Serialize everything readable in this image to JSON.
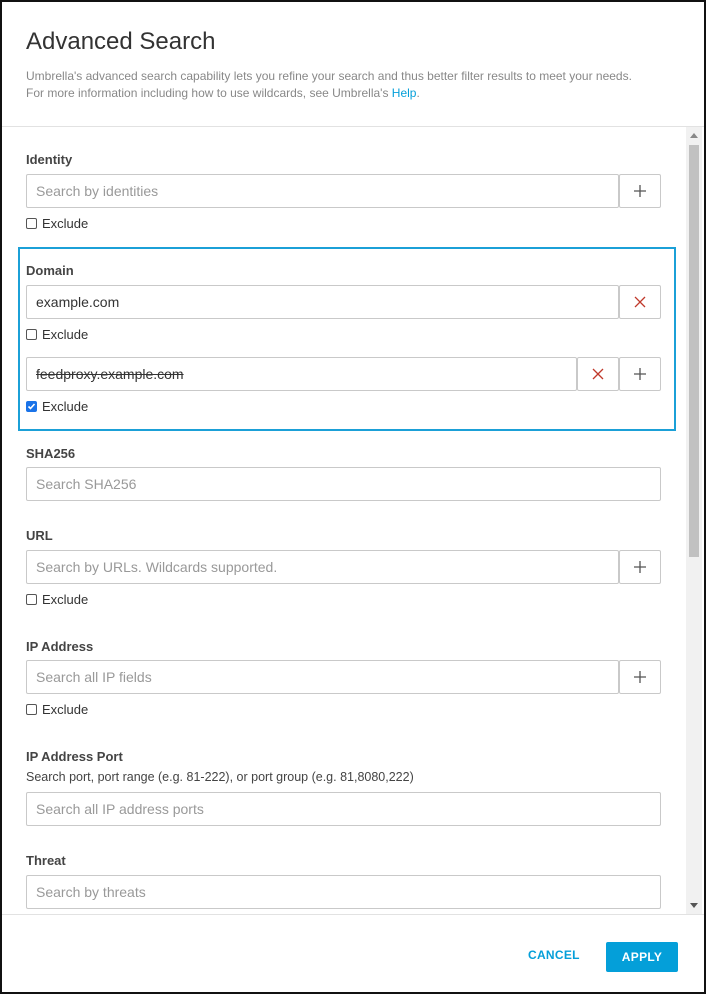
{
  "dialog": {
    "title": "Advanced Search",
    "description_line1": "Umbrella's advanced search capability lets you refine your search and thus better filter results to meet your needs.",
    "description_line2_prefix": "For more information including how to use wildcards, see Umbrella's",
    "help_link": "Help",
    "description_line2_suffix": "."
  },
  "identity": {
    "label": "Identity",
    "placeholder": "Search by identities",
    "exclude_label": "Exclude",
    "exclude_checked": false
  },
  "domain": {
    "label": "Domain",
    "entries": [
      {
        "value": "example.com",
        "exclude_label": "Exclude",
        "exclude_checked": false
      },
      {
        "value": "feedproxy.example.com",
        "exclude_label": "Exclude",
        "exclude_checked": true
      }
    ]
  },
  "sha256": {
    "label": "SHA256",
    "placeholder": "Search SHA256"
  },
  "url": {
    "label": "URL",
    "placeholder": "Search by URLs. Wildcards supported.",
    "exclude_label": "Exclude",
    "exclude_checked": false
  },
  "ip_address": {
    "label": "IP Address",
    "placeholder": "Search all IP fields",
    "exclude_label": "Exclude",
    "exclude_checked": false
  },
  "ip_port": {
    "label": "IP Address Port",
    "hint": "Search port, port range (e.g. 81-222), or port group (e.g. 81,8080,222)",
    "placeholder": "Search all IP address ports"
  },
  "threat": {
    "label": "Threat",
    "placeholder": "Search by threats"
  },
  "footer": {
    "cancel_label": "CANCEL",
    "apply_label": "APPLY"
  },
  "colors": {
    "accent": "#049fd9",
    "highlight_border": "#1ba0d7",
    "remove_icon": "#c0392b"
  },
  "icons": {
    "add": "plus-icon",
    "remove": "close-icon",
    "check": "checkmark-icon"
  }
}
